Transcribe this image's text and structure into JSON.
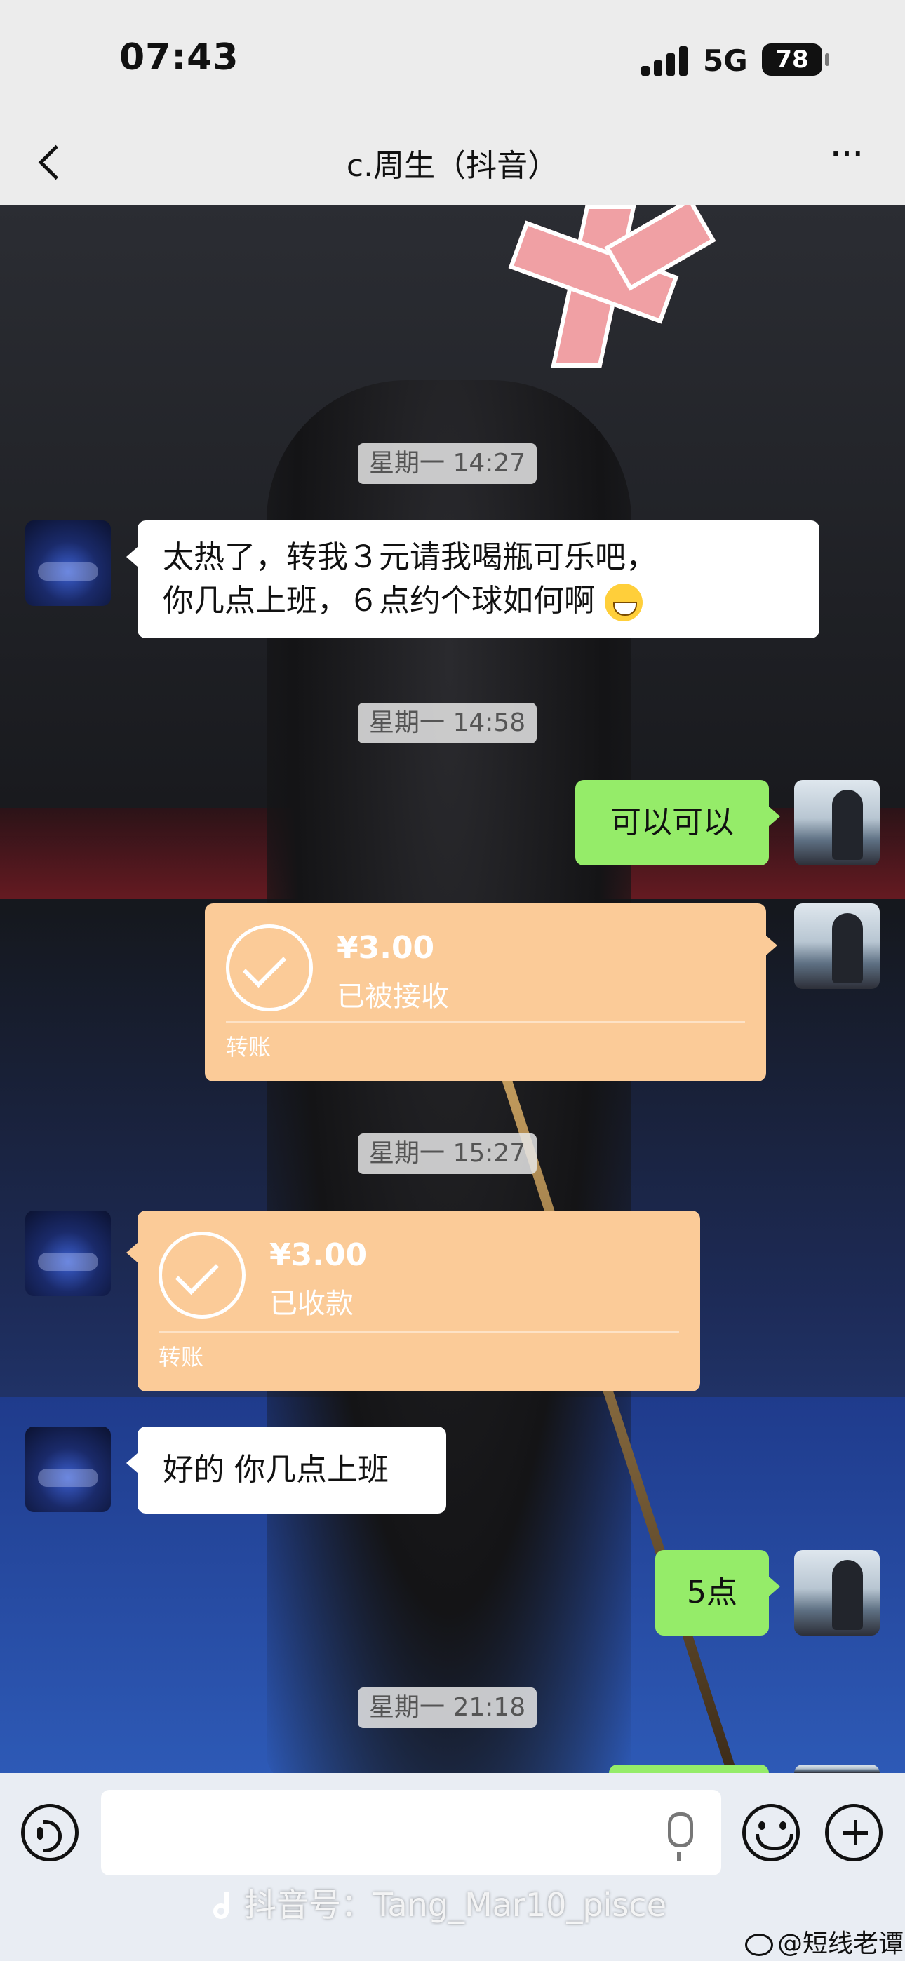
{
  "status_bar": {
    "time": "07:43",
    "network": "5G",
    "battery": "78"
  },
  "nav": {
    "title": "c.周生（抖音）"
  },
  "messages": {
    "ts1": "星期一 14:27",
    "m1_line1": "太热了，转我３元请我喝瓶可乐吧，",
    "m1_line2": "你几点上班，６点约个球如何啊",
    "ts2": "星期一 14:58",
    "m2": "可以可以",
    "transfer1": {
      "amount": "¥3.00",
      "status": "已被接收",
      "label": "转账"
    },
    "ts3": "星期一 15:27",
    "transfer2": {
      "amount": "¥3.00",
      "status": "已收款",
      "label": "转账"
    },
    "m3": "好的 你几点上班",
    "m4": "5点",
    "ts4": "星期一 21:18"
  },
  "watermark": {
    "douyin": "抖音号：Tang_Mar10_pisce",
    "weibo": "@短线老谭"
  },
  "colors": {
    "green_bubble": "#95ec69",
    "transfer": "#fbcb98"
  }
}
